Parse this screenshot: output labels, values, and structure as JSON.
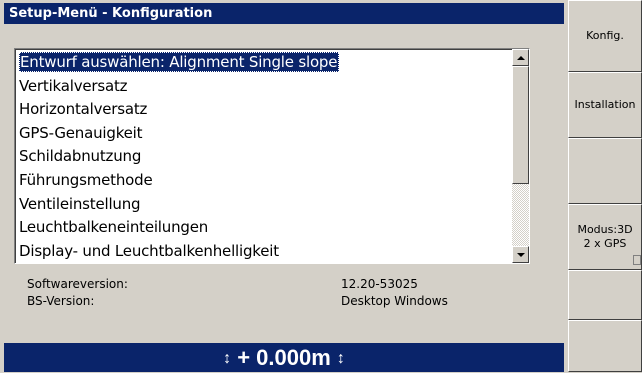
{
  "window": {
    "title": "Setup-Menü - Konfiguration"
  },
  "menu_list": {
    "items": [
      {
        "label": "Entwurf auswählen: Alignment Single slope",
        "selected": true
      },
      {
        "label": "Vertikalversatz",
        "selected": false
      },
      {
        "label": "Horizontalversatz",
        "selected": false
      },
      {
        "label": "GPS-Genauigkeit",
        "selected": false
      },
      {
        "label": "Schildabnutzung",
        "selected": false
      },
      {
        "label": "Führungsmethode",
        "selected": false
      },
      {
        "label": "Ventileinstellung",
        "selected": false
      },
      {
        "label": "Leuchtbalkeneinteilungen",
        "selected": false
      },
      {
        "label": "Display- und Leuchtbalkenhelligkeit",
        "selected": false
      }
    ]
  },
  "info": {
    "software_label": "Softwareversion:",
    "software_value": "12.20-53025",
    "bs_label": "BS-Version:",
    "bs_value": "Desktop Windows"
  },
  "status_bar": {
    "value": "+ 0.000m",
    "arrow_symbol": "↕"
  },
  "side_buttons": {
    "konfig": "Konfig.",
    "installation": "Installation",
    "modus_line1": "Modus:3D",
    "modus_line2": "2 x GPS"
  },
  "colors": {
    "title_bg": "#0a246a",
    "selection_bg": "#0a246a",
    "panel_bg": "#d4d0c8"
  }
}
